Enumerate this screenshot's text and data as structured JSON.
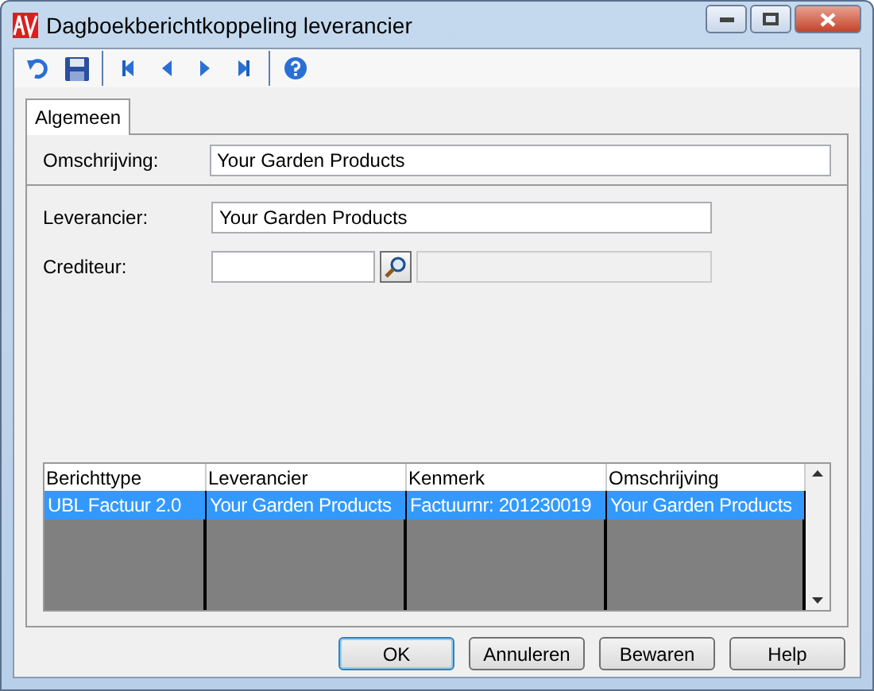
{
  "window": {
    "title": "Dagboekberichtkoppeling leverancier"
  },
  "tabs": [
    {
      "label": "Algemeen",
      "selected": true
    }
  ],
  "fields": [
    {
      "label": "Omschrijving:",
      "value": "Your Garden Products",
      "kind": "wide"
    },
    {
      "label": "Leverancier:",
      "value": "Your Garden Products",
      "kind": "text"
    },
    {
      "label": "Crediteur:",
      "kind": "lookup"
    }
  ],
  "table": {
    "columns": [
      "Berichttype",
      "Leverancier",
      "Kenmerk",
      "Omschrijving"
    ],
    "rows": [
      {
        "cells": [
          "UBL Factuur 2.0",
          "Your Garden Products",
          "Factuurnr: 201230019",
          "Your Garden Products"
        ],
        "selected": true
      }
    ]
  },
  "buttons": [
    {
      "label": "OK",
      "default": true
    },
    {
      "label": "Annuleren",
      "default": false
    },
    {
      "label": "Bewaren",
      "default": false
    },
    {
      "label": "Help",
      "default": false
    }
  ]
}
